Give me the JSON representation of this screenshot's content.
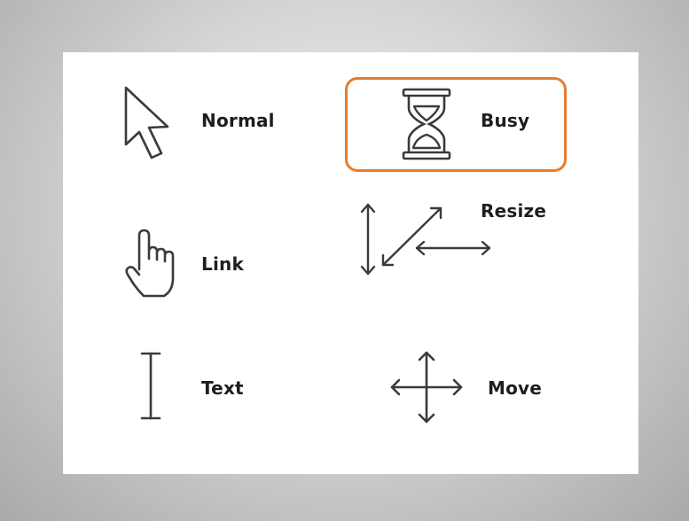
{
  "cursors": {
    "normal": {
      "label": "Normal",
      "icon": "arrow-pointer-icon"
    },
    "busy": {
      "label": "Busy",
      "icon": "hourglass-icon",
      "highlight_color": "#e87c2e"
    },
    "link": {
      "label": "Link",
      "icon": "pointing-hand-icon"
    },
    "resize": {
      "label": "Resize",
      "icon": "resize-arrows-icon"
    },
    "text": {
      "label": "Text",
      "icon": "i-beam-icon"
    },
    "move": {
      "label": "Move",
      "icon": "move-arrows-icon"
    }
  }
}
